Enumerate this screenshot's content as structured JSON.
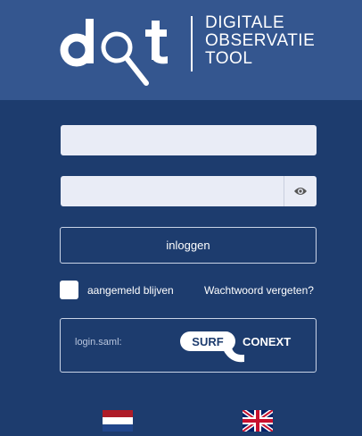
{
  "logo": {
    "mark": "dot",
    "line1": "DIGITALE",
    "line2": "OBSERVATIE",
    "line3": "TOOL"
  },
  "form": {
    "username_value": "",
    "password_value": "",
    "login_label": "inloggen",
    "remember_label": "aangemeld blijven",
    "forgot_label": "Wachtwoord vergeten?"
  },
  "saml": {
    "label": "login.saml:",
    "surf_word": "SURF",
    "conext_word": "CONEXT"
  },
  "languages": [
    "nl-flag-icon",
    "uk-flag-icon"
  ],
  "colors": {
    "background": "#1d3c6e",
    "header": "#34568f",
    "input": "#e9ecf6",
    "border": "#c9d3e6"
  }
}
